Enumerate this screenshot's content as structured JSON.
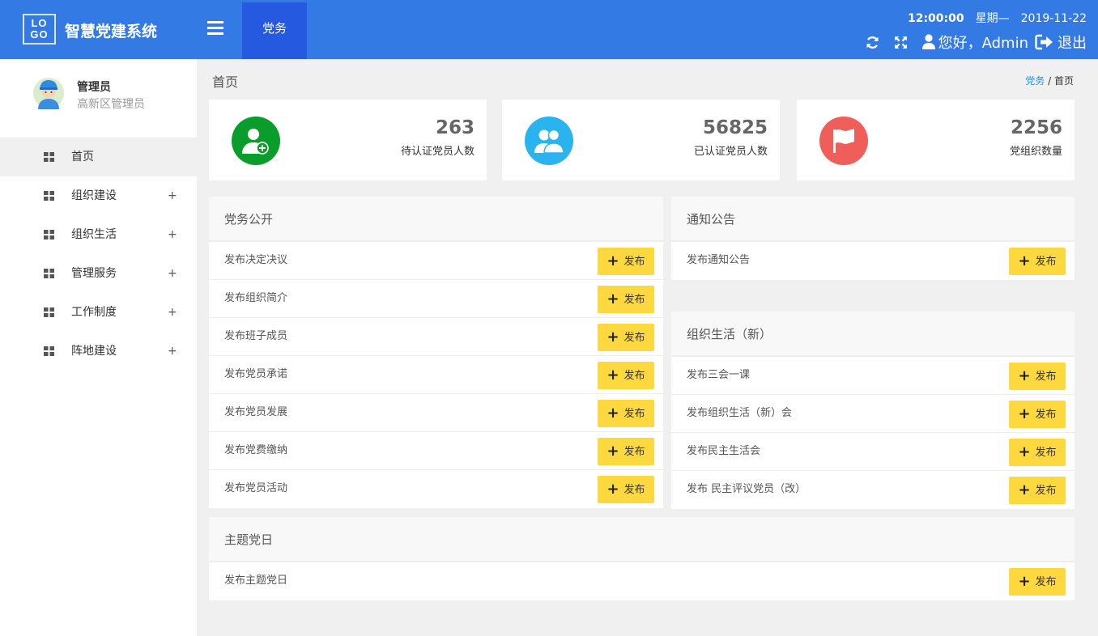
{
  "header": {
    "logo": {
      "line1": "LO",
      "line2": "GO"
    },
    "title": "智慧党建系统",
    "tab": "党务",
    "time": "12:00:00",
    "weekday": "星期—",
    "date": "2019-11-22",
    "greeting": "您好，Admin",
    "logout": "退出",
    "icons": [
      "menu-icon",
      "refresh-icon",
      "fullscreen-icon",
      "user-icon",
      "logout-icon"
    ]
  },
  "sidebar": {
    "user": {
      "name": "管理员",
      "role": "高新区管理员"
    },
    "items": [
      {
        "label": "首页",
        "active": true
      },
      {
        "label": "组织建设",
        "plus": "+"
      },
      {
        "label": "组织生活",
        "plus": "+"
      },
      {
        "label": "管理服务",
        "plus": "+"
      },
      {
        "label": "工作制度",
        "plus": "+"
      },
      {
        "label": "阵地建设",
        "plus": "+"
      }
    ]
  },
  "breadcrumb": {
    "heading": "首页",
    "link": "党务",
    "sep": "/",
    "current": "首页"
  },
  "stats": [
    {
      "value": "263",
      "label": "待认证党员人数",
      "color": "#0a9d2b",
      "icon": "user-add-icon"
    },
    {
      "value": "56825",
      "label": "已认证党员人数",
      "color": "#29b4f0",
      "icon": "users-icon"
    },
    {
      "value": "2256",
      "label": "党组织数量",
      "color": "#ef5e58",
      "icon": "flag-icon"
    }
  ],
  "button_label": "发布",
  "panels": {
    "party_affairs": {
      "title": "党务公开",
      "rows": [
        "发布决定决议",
        "发布组织简介",
        "发布班子成员",
        "发布党员承诺",
        "发布党员发展",
        "发布党费缴纳",
        "发布党员活动"
      ]
    },
    "notice": {
      "title": "通知公告",
      "rows": [
        "发布通知公告"
      ]
    },
    "org_life": {
      "title": "组织生活（新）",
      "rows": [
        "发布三会一课",
        "发布组织生活（新）会",
        "发布民主生活会",
        "发布  民主评议党员（改）"
      ]
    },
    "theme_day": {
      "title": "主题党日",
      "rows": [
        "发布主题党日"
      ]
    }
  },
  "colors": {
    "header": "#337ae5",
    "active_tab": "#2559e0",
    "button": "#fdd93f",
    "link": "#2c8fd6"
  }
}
